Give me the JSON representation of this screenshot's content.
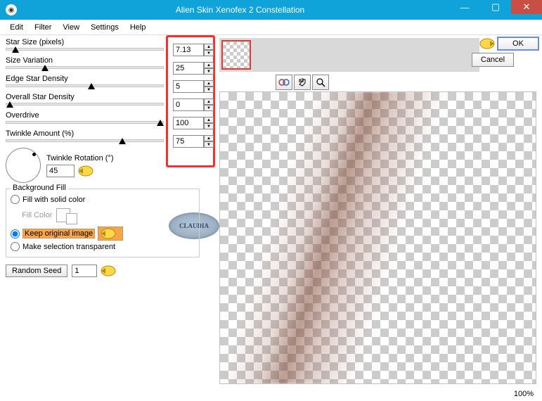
{
  "window": {
    "title": "Alien Skin Xenofex 2 Constellation"
  },
  "menu": {
    "edit": "Edit",
    "filter": "Filter",
    "view": "View",
    "settings": "Settings",
    "help": "Help"
  },
  "sliders": {
    "star_size": {
      "label": "Star Size (pixels)",
      "value": "7.13"
    },
    "size_variation": {
      "label": "Size Variation",
      "value": "25"
    },
    "edge_density": {
      "label": "Edge Star Density",
      "value": "5"
    },
    "overall_density": {
      "label": "Overall Star Density",
      "value": "0"
    },
    "overdrive": {
      "label": "Overdrive",
      "value": "100"
    },
    "twinkle_amount": {
      "label": "Twinkle Amount (%)",
      "value": "75"
    }
  },
  "rotation": {
    "label": "Twinkle Rotation (°)",
    "value": "45"
  },
  "bg_fill": {
    "group_label": "Background Fill",
    "solid": "Fill with solid color",
    "fill_color_label": "Fill Color",
    "keep": "Keep original image",
    "transparent": "Make selection transparent"
  },
  "random_seed": {
    "button": "Random Seed",
    "value": "1"
  },
  "buttons": {
    "ok": "OK",
    "cancel": "Cancel"
  },
  "zoom": "100%",
  "badge": "CLAUDIA"
}
